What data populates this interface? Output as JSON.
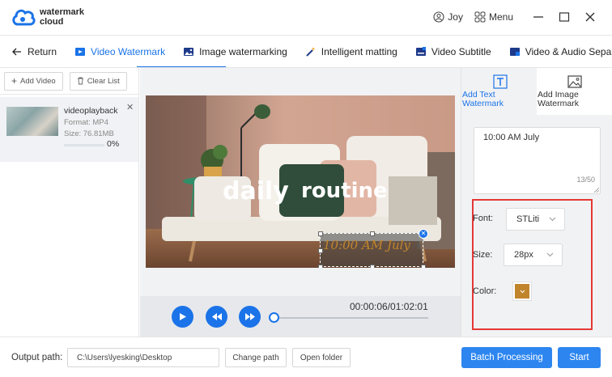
{
  "app": {
    "brand_line1": "watermark",
    "brand_line2": "cloud",
    "user_name": "Joy",
    "menu_label": "Menu",
    "accent_color": "#1a73e8"
  },
  "tabs": [
    {
      "label": "Return",
      "icon": "arrow-left-icon"
    },
    {
      "label": "Video Watermark",
      "icon": "video-watermark-icon",
      "active": true
    },
    {
      "label": "Image watermarking",
      "icon": "image-icon"
    },
    {
      "label": "Intelligent matting",
      "icon": "magic-wand-icon"
    },
    {
      "label": "Video Subtitle",
      "icon": "subtitle-icon"
    },
    {
      "label": "Video & Audio Sepa",
      "icon": "video-audio-icon"
    }
  ],
  "file_panel": {
    "add_video_label": "Add Video",
    "clear_list_label": "Clear List",
    "file": {
      "name": "videoplayback",
      "format": "Format:  MP4",
      "size": "Size:  76.81MB",
      "progress": "0%"
    }
  },
  "preview": {
    "overlay_title_1": "daily",
    "overlay_title_2": "routine",
    "watermark_text": "10:00 AM July",
    "time_display": "00:00:06/01:02:01",
    "playback_progress": 0.0
  },
  "settings": {
    "tab_text_label_1": "Add Text",
    "tab_text_label_2": "Watermark",
    "tab_image_label_1": "Add Image",
    "tab_image_label_2": "Watermark",
    "text_value": "10:00 AM July",
    "char_count": "13/50",
    "font_label": "Font:",
    "font_value": "STLiti",
    "size_label": "Size:",
    "size_value": "28px",
    "color_label": "Color:",
    "color_value": "#c0852b"
  },
  "footer": {
    "output_label": "Output path:",
    "output_path": "C:\\Users\\lyesking\\Desktop",
    "change_path_label": "Change path",
    "open_folder_label": "Open folder",
    "batch_label": "Batch Processing",
    "start_label": "Start"
  }
}
